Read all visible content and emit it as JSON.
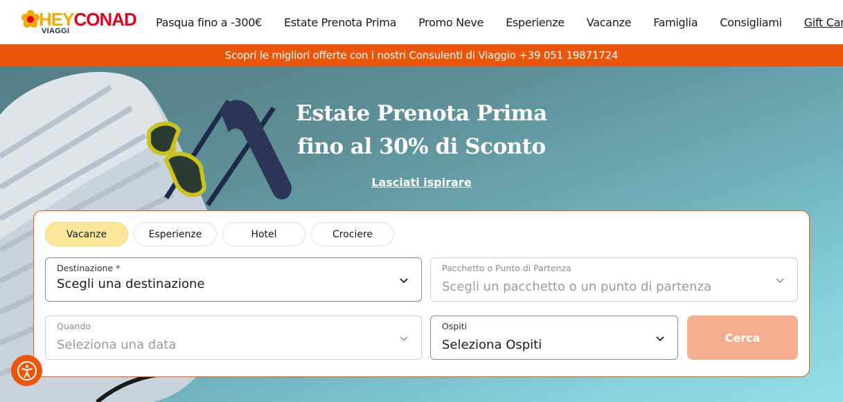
{
  "brand": {
    "hey": "HEY",
    "conad": "CONAD",
    "sub": "VIAGGI"
  },
  "nav": [
    {
      "label": "Pasqua fino a -300€"
    },
    {
      "label": "Estate Prenota Prima"
    },
    {
      "label": "Promo Neve"
    },
    {
      "label": "Esperienze"
    },
    {
      "label": "Vacanze"
    },
    {
      "label": "Famiglia"
    },
    {
      "label": "Consigliami"
    },
    {
      "label": "Gift Card"
    }
  ],
  "promo_bar": {
    "text": "Scopri le migliori offerte con i nostri Consulenti di Viaggio +39 051 19871724"
  },
  "hero": {
    "title_line1": "Estate Prenota Prima",
    "title_line2": "fino al 30% di Sconto",
    "link": "Lasciati ispirare"
  },
  "search": {
    "tabs": [
      {
        "label": "Vacanze",
        "active": true
      },
      {
        "label": "Esperienze",
        "active": false
      },
      {
        "label": "Hotel",
        "active": false
      },
      {
        "label": "Crociere",
        "active": false
      }
    ],
    "destination": {
      "label": "Destinazione *",
      "value": "Scegli una destinazione"
    },
    "package": {
      "label": "Pacchetto o Punto di Partenza",
      "placeholder": "Scegli un pacchetto o un punto di partenza"
    },
    "when": {
      "label": "Quando",
      "placeholder": "Seleziona una data"
    },
    "guests": {
      "label": "Ospiti",
      "value": "Seleziona Ospiti"
    },
    "submit": "Cerca"
  },
  "colors": {
    "accent": "#ec560b",
    "tab_active": "#fbe79a",
    "submit_disabled": "#f5ae8f"
  },
  "icons": {
    "logo": "flower-logo-icon",
    "chevron": "chevron-down-icon",
    "accessibility": "accessibility-icon"
  }
}
